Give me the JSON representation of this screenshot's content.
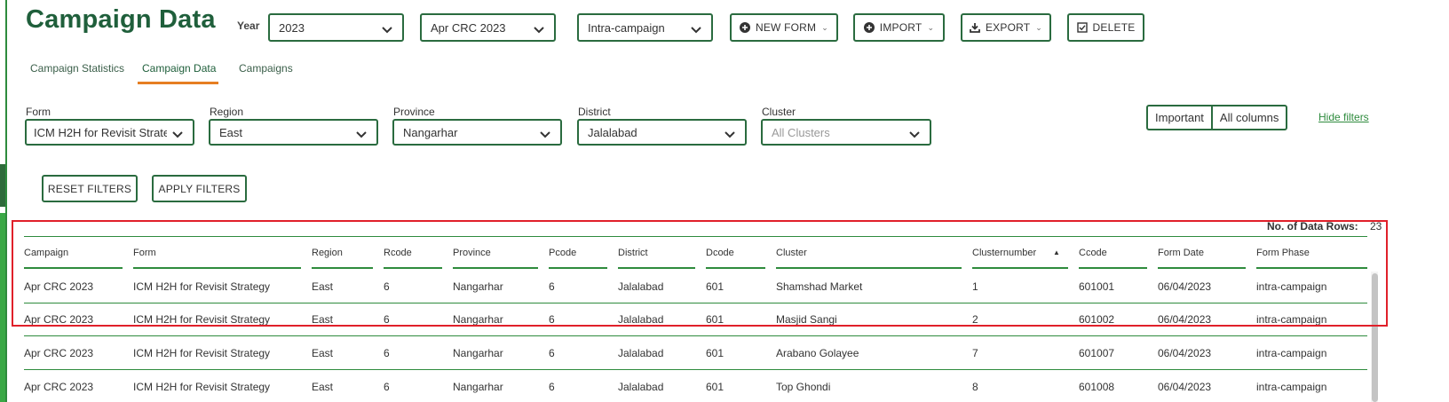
{
  "title": "Campaign Data",
  "toolbar": {
    "year_label": "Year",
    "year_value": "2023",
    "campaign_value": "Apr CRC 2023",
    "phase_value": "Intra-campaign",
    "new_form_label": "NEW FORM",
    "import_label": "IMPORT",
    "export_label": "EXPORT",
    "delete_label": "DELETE"
  },
  "tabs": [
    {
      "label": "Campaign Statistics"
    },
    {
      "label": "Campaign Data"
    },
    {
      "label": "Campaigns"
    }
  ],
  "filters": {
    "form": {
      "label": "Form",
      "value": "ICM H2H for Revisit Strategy"
    },
    "region": {
      "label": "Region",
      "value": "East"
    },
    "province": {
      "label": "Province",
      "value": "Nangarhar"
    },
    "district": {
      "label": "District",
      "value": "Jalalabad"
    },
    "cluster": {
      "label": "Cluster",
      "placeholder": "All Clusters"
    },
    "reset_label": "RESET FILTERS",
    "apply_label": "APPLY FILTERS"
  },
  "column_toggle": {
    "important": "Important",
    "all": "All columns"
  },
  "hide_filters_label": "Hide filters",
  "rows_info": {
    "label": "No. of Data Rows:",
    "count": "23"
  },
  "table": {
    "columns": [
      "Campaign",
      "Form",
      "Region",
      "Rcode",
      "Province",
      "Pcode",
      "District",
      "Dcode",
      "Cluster",
      "Clusternumber",
      "Ccode",
      "Form Date",
      "Form Phase"
    ],
    "rows": [
      [
        "Apr CRC 2023",
        "ICM H2H for Revisit Strategy",
        "East",
        "6",
        "Nangarhar",
        "6",
        "Jalalabad",
        "601",
        "Shamshad Market",
        "1",
        "601001",
        "06/04/2023",
        "intra-campaign"
      ],
      [
        "Apr CRC 2023",
        "ICM H2H for Revisit Strategy",
        "East",
        "6",
        "Nangarhar",
        "6",
        "Jalalabad",
        "601",
        "Masjid Sangi",
        "2",
        "601002",
        "06/04/2023",
        "intra-campaign"
      ],
      [
        "Apr CRC 2023",
        "ICM H2H for Revisit Strategy",
        "East",
        "6",
        "Nangarhar",
        "6",
        "Jalalabad",
        "601",
        "Arabano Golayee",
        "7",
        "601007",
        "06/04/2023",
        "intra-campaign"
      ],
      [
        "Apr CRC 2023",
        "ICM H2H for Revisit Strategy",
        "East",
        "6",
        "Nangarhar",
        "6",
        "Jalalabad",
        "601",
        "Top Ghondi",
        "8",
        "601008",
        "06/04/2023",
        "intra-campaign"
      ]
    ]
  },
  "colors": {
    "accent": "#1f5f3b",
    "border": "#2a6b3f",
    "tab_underline": "#e67e22",
    "highlight": "#e0202a"
  }
}
